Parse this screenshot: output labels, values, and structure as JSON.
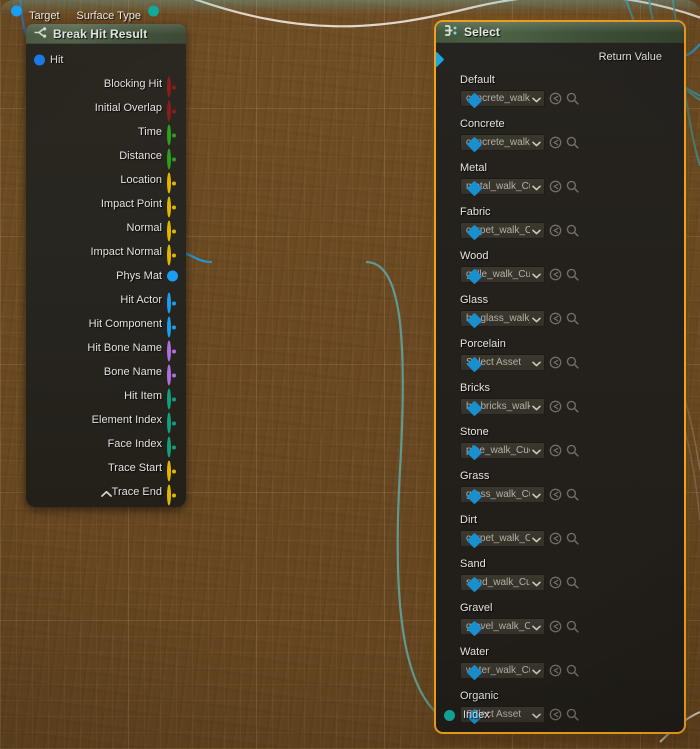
{
  "editor": {
    "app": "Unreal Engine Blueprint Graph",
    "background_color": "#6b4a22",
    "grid_color": "#8a6a3a"
  },
  "nodes": {
    "break_hit_result": {
      "title": "Break Hit Result",
      "icon": "break-struct-icon",
      "collapse_icon": "chevron-up-icon",
      "inputs": [
        {
          "label": "Hit",
          "pin": "struct-pin",
          "color": "#1a7ef0",
          "shape": "filled",
          "connected": true
        }
      ],
      "outputs": [
        {
          "label": "Blocking Hit",
          "pin": "bool-pin",
          "color": "#8c1c1c",
          "shape": "eye"
        },
        {
          "label": "Initial Overlap",
          "pin": "bool-pin",
          "color": "#8c1c1c",
          "shape": "eye"
        },
        {
          "label": "Time",
          "pin": "float-pin",
          "color": "#2ea01f",
          "shape": "eye"
        },
        {
          "label": "Distance",
          "pin": "float-pin",
          "color": "#2ea01f",
          "shape": "eye"
        },
        {
          "label": "Location",
          "pin": "vector-pin",
          "color": "#e2b500",
          "shape": "eye"
        },
        {
          "label": "Impact Point",
          "pin": "vector-pin",
          "color": "#e2b500",
          "shape": "eye"
        },
        {
          "label": "Normal",
          "pin": "vector-pin",
          "color": "#e2b500",
          "shape": "eye"
        },
        {
          "label": "Impact Normal",
          "pin": "vector-pin",
          "color": "#e2b500",
          "shape": "eye"
        },
        {
          "label": "Phys Mat",
          "pin": "object-pin",
          "color": "#1a9ef0",
          "shape": "filled",
          "connected": true
        },
        {
          "label": "Hit Actor",
          "pin": "object-pin",
          "color": "#1a9ef0",
          "shape": "eye"
        },
        {
          "label": "Hit Component",
          "pin": "object-pin",
          "color": "#1a9ef0",
          "shape": "eye"
        },
        {
          "label": "Hit Bone Name",
          "pin": "name-pin",
          "color": "#b06ee0",
          "shape": "eye"
        },
        {
          "label": "Bone Name",
          "pin": "name-pin",
          "color": "#b06ee0",
          "shape": "eye"
        },
        {
          "label": "Hit Item",
          "pin": "int-pin",
          "color": "#10a080",
          "shape": "eye"
        },
        {
          "label": "Element Index",
          "pin": "int-pin",
          "color": "#10a080",
          "shape": "eye"
        },
        {
          "label": "Face Index",
          "pin": "int-pin",
          "color": "#10a080",
          "shape": "eye"
        },
        {
          "label": "Trace Start",
          "pin": "vector-pin",
          "color": "#e2b500",
          "shape": "eye"
        },
        {
          "label": "Trace End",
          "pin": "vector-pin",
          "color": "#e2b500",
          "shape": "eye"
        }
      ]
    },
    "surface_type": {
      "input_label": "Target",
      "input_pin_color": "#1a9ef0",
      "output_label": "Surface Type",
      "output_pin_color": "#12a89a"
    },
    "select": {
      "title": "Select",
      "icon": "select-node-icon",
      "selected": true,
      "selection_color": "#f0a022",
      "return_value_label": "Return Value",
      "return_value_pin_color": "#17a9df",
      "index_label": "Index",
      "index_pin_color": "#12a89a",
      "pin_color": "#1a8fd0",
      "options": [
        {
          "name": "Default",
          "value": "concrete_walk_"
        },
        {
          "name": "Concrete",
          "value": "concrete_walk_"
        },
        {
          "name": "Metal",
          "value": "metal_walk_Cu"
        },
        {
          "name": "Fabric",
          "value": "carpet_walk_Cu"
        },
        {
          "name": "Wood",
          "value": "grille_walk_Cue"
        },
        {
          "name": "Glass",
          "value": "br_glass_walk_"
        },
        {
          "name": "Porcelain",
          "value": "Select Asset"
        },
        {
          "name": "Bricks",
          "value": "br_bricks_walk"
        },
        {
          "name": "Stone",
          "value": "pipe_walk_Cue"
        },
        {
          "name": "Grass",
          "value": "grass_walk_Cu"
        },
        {
          "name": "Dirt",
          "value": "carpet_walk_Cu"
        },
        {
          "name": "Sand",
          "value": "sand_walk_Cue"
        },
        {
          "name": "Gravel",
          "value": "gravel_walk_Cu"
        },
        {
          "name": "Water",
          "value": "water_walk_Cu"
        },
        {
          "name": "Organic",
          "value": "Select Asset"
        }
      ],
      "control_icons": [
        "use-selected-asset-icon",
        "browse-to-asset-icon"
      ],
      "dropdown_icon": "chevron-down-icon"
    }
  },
  "wires": {
    "color_exec_teal": "#5f9a92",
    "color_object_blue": "#2a93c9",
    "color_white": "#d8d4cc"
  }
}
